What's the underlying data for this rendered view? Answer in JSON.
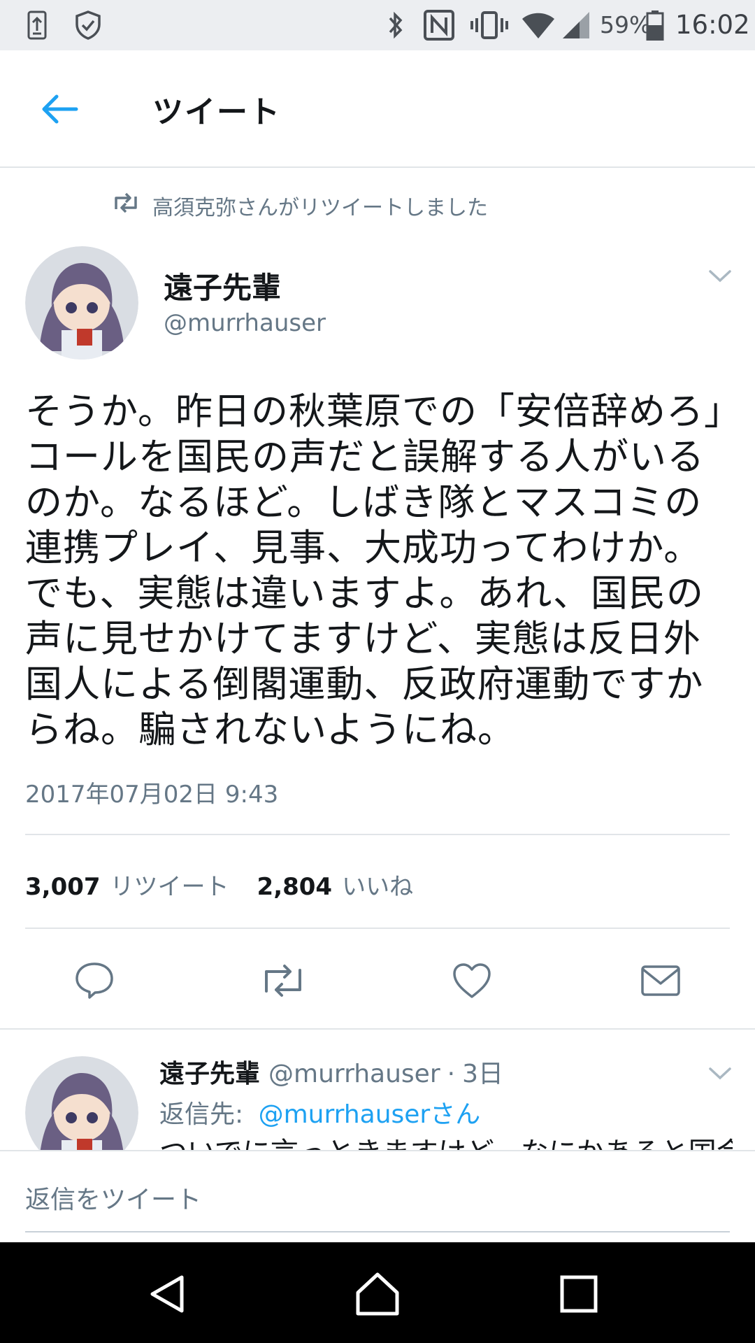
{
  "status_bar": {
    "battery": "59%",
    "time": "16:02"
  },
  "header": {
    "title": "ツイート"
  },
  "retweet_notice": "高須克弥さんがリツイートしました",
  "tweet": {
    "author_name": "遠子先輩",
    "author_handle": "@murrhauser",
    "text": "そうか。昨日の秋葉原での「安倍辞めろ」コールを国民の声だと誤解する人がいるのか。なるほど。しばき隊とマスコミの連携プレイ、見事、大成功ってわけか。でも、実態は違いますよ。あれ、国民の声に見せかけてますけど、実態は反日外国人による倒閣運動、反政府運動ですからね。騙されないようにね。",
    "date": "2017年07月02日 9:43",
    "retweet_count": "3,007",
    "retweet_label": "リツイート",
    "like_count": "2,804",
    "like_label": "いいね"
  },
  "reply": {
    "author_name": "遠子先輩",
    "author_handle": "@murrhauser",
    "separator": "·",
    "time": "3日",
    "reply_to_label": "返信先:",
    "reply_to_link": "@murrhauserさん",
    "snippet": "ついでに言っときますけど、なにかあると国会"
  },
  "compose": {
    "placeholder": "返信をツイート"
  },
  "colors": {
    "accent": "#1da1f2",
    "secondary_text": "#657786",
    "status_bar_bg": "#eceef1",
    "nav_bar_bg": "#000000"
  },
  "icons": {
    "status_left": [
      "screen-share-icon",
      "shield-check-icon"
    ],
    "status_right": [
      "bluetooth-icon",
      "nfc-icon",
      "vibrate-icon",
      "wifi-icon",
      "signal-icon",
      "battery-icon"
    ],
    "actions": [
      "reply-icon",
      "retweet-icon",
      "like-icon",
      "dm-icon"
    ],
    "navigation": [
      "back-triangle-icon",
      "home-circle-icon",
      "recents-square-icon"
    ]
  }
}
